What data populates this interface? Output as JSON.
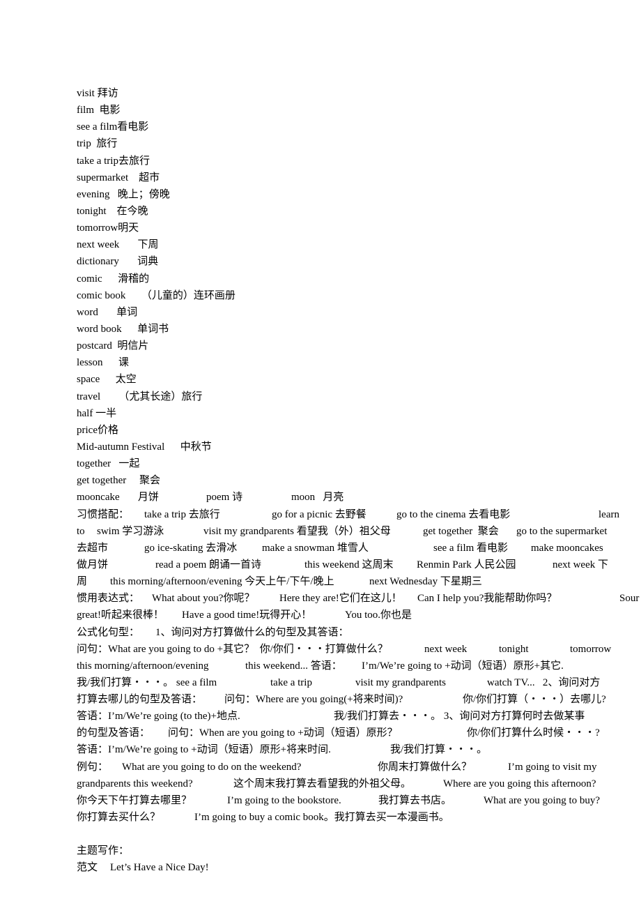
{
  "vocab": [
    [
      "visit 拜访"
    ],
    [
      "film  电影"
    ],
    [
      "see a film看电影"
    ],
    [
      "trip  旅行"
    ],
    [
      "take a trip去旅行"
    ],
    [
      "supermarket    超市"
    ],
    [
      "evening   晚上；傍晚"
    ],
    [
      "tonight    在今晚"
    ],
    [
      "tomorrow明天"
    ],
    [
      "next week       下周"
    ],
    [
      "dictionary       词典"
    ],
    [
      "comic      滑稽的"
    ],
    [
      "comic book      （儿童的）连环画册"
    ],
    [
      "word       单词"
    ],
    [
      "word book      单词书"
    ],
    [
      "postcard  明信片"
    ],
    [
      "lesson      课"
    ],
    [
      "space      太空"
    ],
    [
      "travel       （尤其长途）旅行"
    ],
    [
      "half 一半"
    ],
    [
      "price价格"
    ],
    [
      "Mid-autumn Festival      中秋节"
    ],
    [
      "together   一起"
    ],
    [
      "get together     聚会"
    ]
  ],
  "vocab_multi": [
    "mooncake       月饼",
    "poem 诗",
    "moon   月亮"
  ],
  "collocations": [
    [
      "习惯搭配：",
      "take a trip 去旅行",
      "go for a picnic 去野餐",
      "go to the cinema 去看电影",
      "learn"
    ],
    [
      "to",
      "swim 学习游泳",
      "visit my grandparents 看望我（外）祖父母",
      "get together  聚会",
      "go to the supermarket"
    ],
    [
      "去超市",
      "go ice-skating 去滑冰",
      "make a snowman 堆雪人",
      "see a film 看电影",
      "make mooncakes"
    ],
    [
      "做月饼",
      "read a poem 朗诵一首诗",
      "this weekend 这周末",
      "Renmin Park 人民公园",
      "next week 下"
    ],
    [
      "周",
      "this morning/afternoon/evening 今天上午/下午/晚上",
      "next Wednesday 下星期三"
    ]
  ],
  "expressions": [
    [
      "惯用表达式：",
      "What about you?你呢？",
      "Here they are!它们在这儿！",
      "Can I help you?我能帮助你吗？",
      "Sour"
    ],
    [
      "great!听起来很棒！",
      "Have a good time!玩得开心！",
      "You too.你也是"
    ]
  ],
  "patterns": [
    [
      "公式化句型：",
      "1、询问对方打算做什么的句型及其答语："
    ],
    [
      "问句：What are you going to do +其它？  你/你们・・・打算做什么？",
      "next week",
      "tonight",
      "tomorrow"
    ],
    [
      "this morning/afternoon/evening",
      "this weekend... 答语：",
      "I’m/We’re going to +动词（短语）原形+其它."
    ],
    [
      "我/我们打算・・・。 see a film",
      "take a trip",
      "visit my grandparents",
      "watch TV...   2、询问对方"
    ],
    [
      "打算去哪儿的句型及答语：",
      "问句：Where are you going(+将来时间)?",
      "你/你们打算（・・・）去哪儿?"
    ],
    [
      "答语：I’m/We’re going (to the)+地点.",
      "我/我们打算去・・・。 3、询问对方打算何时去做某事"
    ],
    [
      "的句型及答语：",
      "问句：When are you going to +动词（短语）原形？",
      "你/你们打算什么时候・・・?"
    ],
    [
      "答语：I’m/We’re going to +动词（短语）原形+将来时间.",
      "我/我们打算・・・。"
    ]
  ],
  "examples": [
    [
      "例句：",
      "What are you going to do on the weekend?",
      "你周末打算做什么？",
      "I’m going to visit my"
    ],
    [
      "grandparents this weekend?",
      "这个周末我打算去看望我的外祖父母。",
      "Where are you going this afternoon?"
    ],
    [
      "你今天下午打算去哪里？",
      "I’m going to the bookstore.",
      "我打算去书店。",
      "What are you going to buy?"
    ],
    [
      "你打算去买什么？",
      "I’m going to buy a comic book。我打算去买一本漫画书。"
    ]
  ],
  "writing": {
    "heading": "主题写作：",
    "sample_label": "范文",
    "sample_title": "Let’s Have a Nice Day!"
  }
}
